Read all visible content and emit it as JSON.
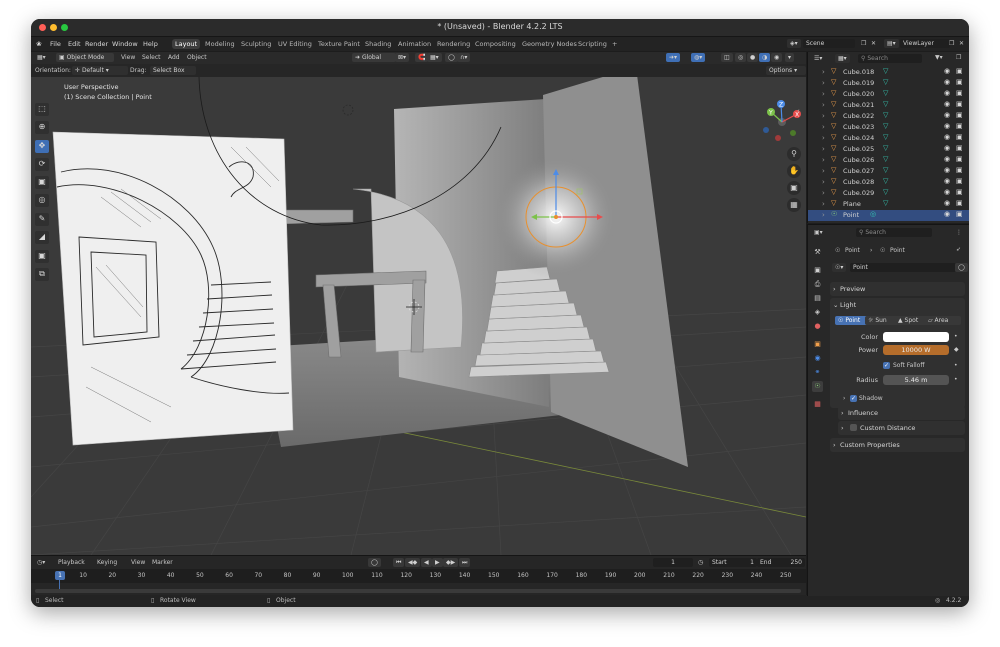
{
  "window": {
    "title": "* (Unsaved) - Blender 4.2.2 LTS"
  },
  "menu": {
    "items": [
      "File",
      "Edit",
      "Render",
      "Window",
      "Help"
    ],
    "workspaces": [
      "Layout",
      "Modeling",
      "Sculpting",
      "UV Editing",
      "Texture Paint",
      "Shading",
      "Animation",
      "Rendering",
      "Compositing",
      "Geometry Nodes",
      "Scripting"
    ],
    "active_workspace": "Layout",
    "add_tab": "+",
    "scene_label": "Scene",
    "viewlayer_label": "ViewLayer"
  },
  "viewport_header": {
    "mode": "Object Mode",
    "menus": [
      "View",
      "Select",
      "Add",
      "Object"
    ],
    "transform_orientation": "Global",
    "orientation_label": "Orientation:",
    "orientation_value": "Default",
    "drag_label": "Drag:",
    "drag_value": "Select Box",
    "options_label": "Options"
  },
  "viewport": {
    "overlay_line1": "User Perspective",
    "overlay_line2": "(1) Scene Collection | Point",
    "gizmo_axes": {
      "x": "X",
      "y": "Y",
      "z": "Z"
    }
  },
  "tools": [
    "cursor",
    "move",
    "rotate",
    "scale",
    "transform",
    "annotate",
    "measure",
    "add-cube",
    "add-object"
  ],
  "outliner": {
    "search_placeholder": "Search",
    "rows": [
      {
        "name": "Cube.018",
        "type": "mesh"
      },
      {
        "name": "Cube.019",
        "type": "mesh"
      },
      {
        "name": "Cube.020",
        "type": "mesh"
      },
      {
        "name": "Cube.021",
        "type": "mesh"
      },
      {
        "name": "Cube.022",
        "type": "mesh"
      },
      {
        "name": "Cube.023",
        "type": "mesh"
      },
      {
        "name": "Cube.024",
        "type": "mesh"
      },
      {
        "name": "Cube.025",
        "type": "mesh"
      },
      {
        "name": "Cube.026",
        "type": "mesh"
      },
      {
        "name": "Cube.027",
        "type": "mesh"
      },
      {
        "name": "Cube.028",
        "type": "mesh"
      },
      {
        "name": "Cube.029",
        "type": "mesh"
      },
      {
        "name": "Plane",
        "type": "mesh"
      },
      {
        "name": "Point",
        "type": "light",
        "selected": true
      }
    ]
  },
  "properties": {
    "search_placeholder": "Search",
    "breadcrumb": [
      "Point",
      "Point"
    ],
    "datablock_name": "Point",
    "panels": {
      "preview": "Preview",
      "light": "Light",
      "shadow": "Shadow",
      "influence": "Influence",
      "custom_distance": "Custom Distance",
      "custom_properties": "Custom Properties"
    },
    "light_types": [
      "Point",
      "Sun",
      "Spot",
      "Area"
    ],
    "active_light_type": "Point",
    "color_label": "Color",
    "color_value": "#ffffff",
    "power_label": "Power",
    "power_value": "10000 W",
    "soft_falloff_label": "Soft Falloff",
    "radius_label": "Radius",
    "radius_value": "5.46 m"
  },
  "timeline": {
    "menus": [
      "Playback",
      "Keying",
      "View",
      "Marker"
    ],
    "current_frame": "1",
    "current_frame_marker": "1",
    "start_label": "Start",
    "start_value": "1",
    "end_label": "End",
    "end_value": "250",
    "ruler": [
      "10",
      "20",
      "30",
      "40",
      "50",
      "60",
      "70",
      "80",
      "90",
      "100",
      "110",
      "120",
      "130",
      "140",
      "150",
      "160",
      "170",
      "180",
      "190",
      "200",
      "210",
      "220",
      "230",
      "240",
      "250"
    ]
  },
  "statusbar": {
    "select": "Select",
    "rotate_view": "Rotate View",
    "object": "Object",
    "version": "4.2.2"
  },
  "colors": {
    "accent_blue": "#4772b3",
    "selection_row": "#334d80",
    "power_field": "#b56d2b",
    "light_icon": "#8bd17a",
    "mesh_icon": "#f2a04c",
    "constraint_icon": "#34c2b0"
  }
}
